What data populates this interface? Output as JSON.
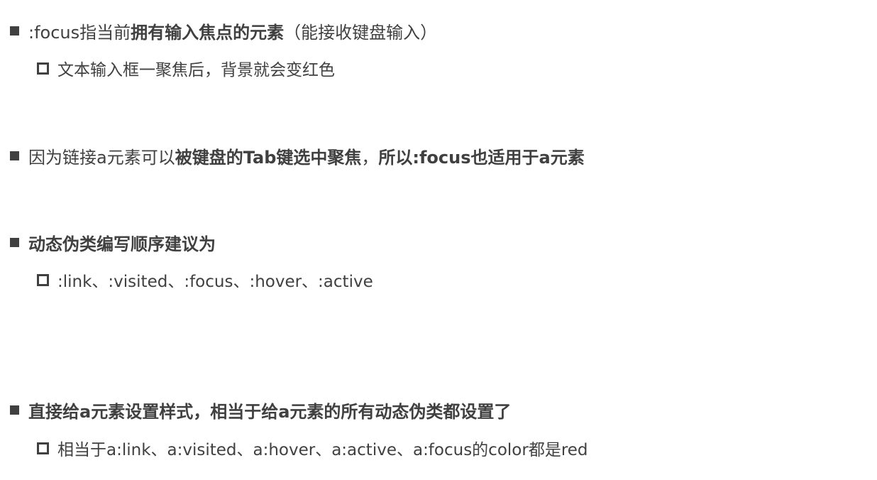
{
  "bullets": [
    {
      "text_a": ":focus指当前",
      "text_b": "拥有输入焦点的元素",
      "text_c": "（能接收键盘输入）",
      "sub": "文本输入框一聚焦后，背景就会变红色"
    },
    {
      "text_a": "因为链接a元素可以",
      "text_b": "被键盘的Tab键选中聚焦",
      "text_c": "，",
      "text_d": "所以:focus也适用于a元素"
    },
    {
      "text_b": "动态伪类编写顺序建议为",
      "sub": ":link、:visited、:focus、:hover、:active"
    },
    {
      "text_b": "直接给a元素设置样式，相当于给a元素的所有动态伪类都设置了",
      "sub": "相当于a:link、a:visited、a:hover、a:active、a:focus的color都是red"
    }
  ],
  "colors": {
    "text": "#404040",
    "background": "#ffffff"
  }
}
